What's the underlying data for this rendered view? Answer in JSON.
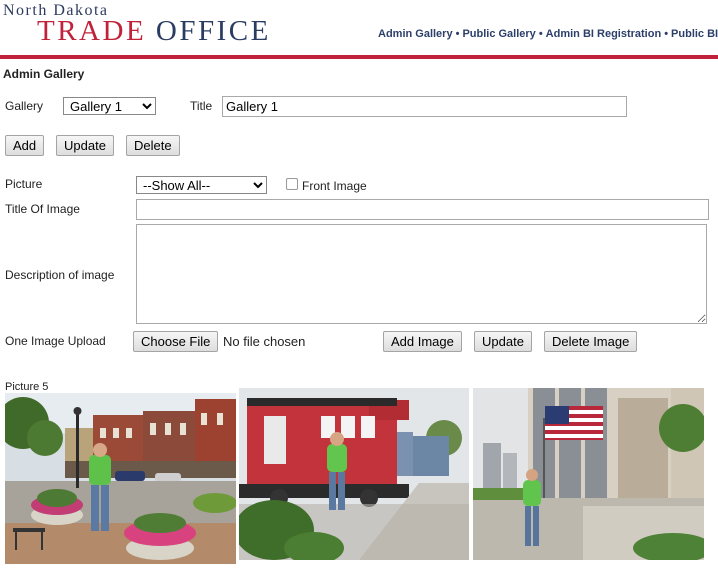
{
  "header": {
    "logo_top": "North Dakota",
    "logo_trade": "TRADE",
    "logo_office": "OFFICE",
    "nav": [
      {
        "label": "Admin Gallery"
      },
      {
        "label": "Public Gallery"
      },
      {
        "label": "Admin BI Registration"
      },
      {
        "label": "Public BI"
      }
    ],
    "separator": "•",
    "colors": {
      "brand_red": "#c0223a",
      "brand_navy": "#2a3c62"
    }
  },
  "page_title": "Admin Gallery",
  "gallery_form": {
    "gallery_label": "Gallery",
    "gallery_selected": "Gallery 1",
    "title_label": "Title",
    "title_value": "Gallery 1",
    "add_label": "Add",
    "update_label": "Update",
    "delete_label": "Delete"
  },
  "image_form": {
    "picture_label": "Picture",
    "picture_selected": "--Show All--",
    "front_image_label": "Front Image",
    "front_image_checked": false,
    "title_of_image_label": "Title Of Image",
    "title_of_image_value": "",
    "description_label": "Description of image",
    "description_value": "",
    "upload_label": "One Image Upload",
    "choose_file_label": "Choose File",
    "no_file_text": "No file chosen",
    "add_image_label": "Add Image",
    "update_label": "Update",
    "delete_image_label": "Delete Image"
  },
  "gallery": {
    "picture_caption": "Picture 5",
    "photos": [
      {
        "icon": "street-flowers-photo"
      },
      {
        "icon": "red-caboose-photo"
      },
      {
        "icon": "flag-building-photo"
      }
    ]
  }
}
